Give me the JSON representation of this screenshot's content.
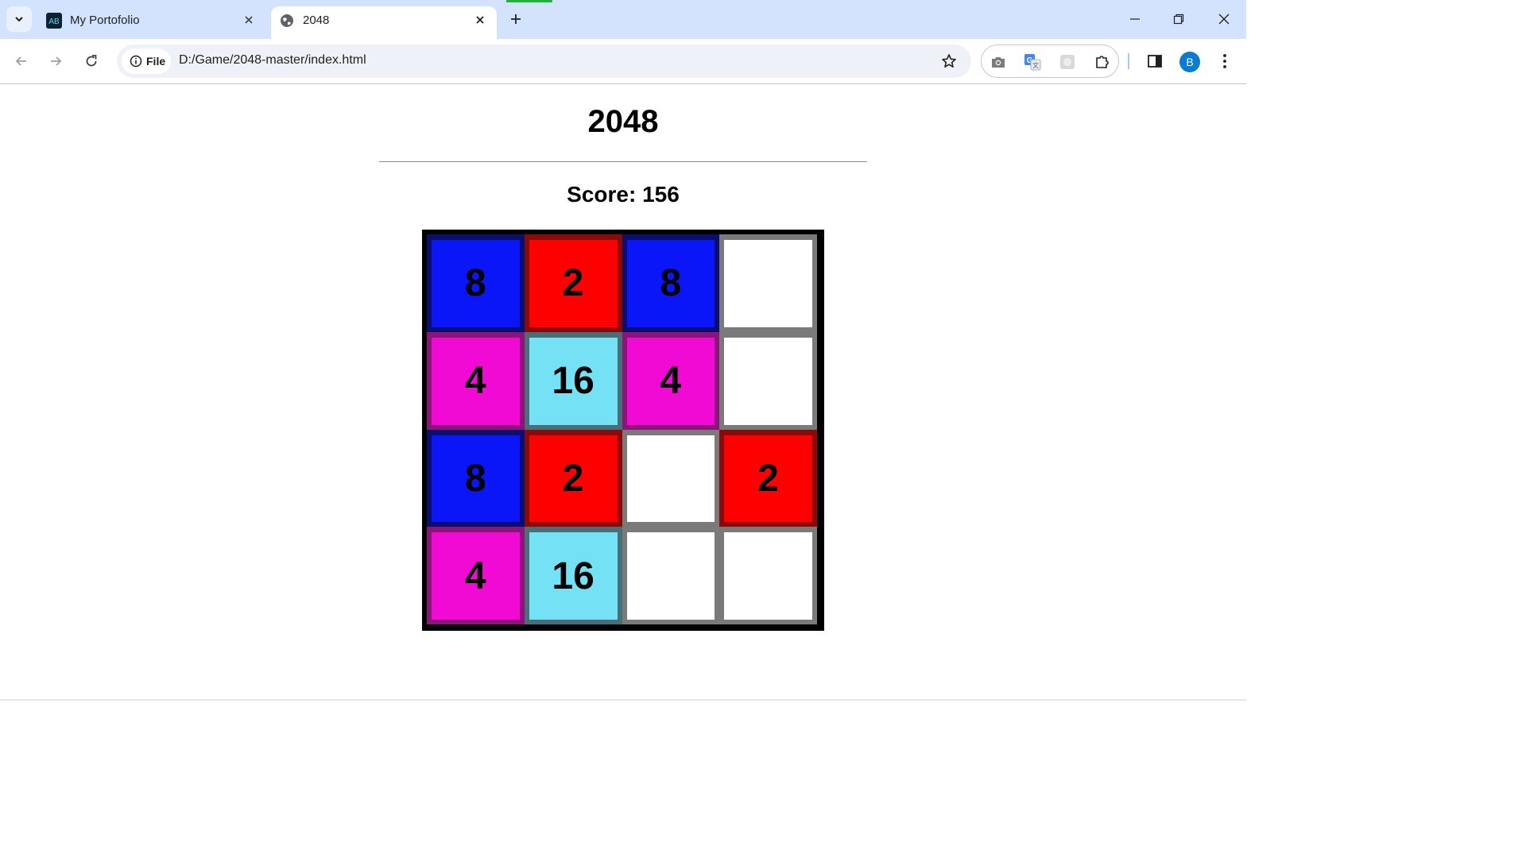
{
  "browser": {
    "tabs": [
      {
        "title": "My Portofolio",
        "icon": "portfolio-favicon",
        "active": false
      },
      {
        "title": "2048",
        "icon": "globe-icon",
        "active": true
      }
    ],
    "address": {
      "chip_label": "File",
      "url": "D:/Game/2048-master/index.html"
    },
    "profile_initial": "B",
    "colors": {
      "tabstrip": "#d3e3fd",
      "omnibox": "#eef1f8",
      "avatar": "#0b7bd1"
    }
  },
  "game": {
    "title": "2048",
    "score_label": "Score: 156",
    "board": [
      [
        "8",
        "2",
        "8",
        ""
      ],
      [
        "4",
        "16",
        "4",
        ""
      ],
      [
        "8",
        "2",
        "",
        "2"
      ],
      [
        "4",
        "16",
        "",
        ""
      ]
    ],
    "tile_colors": {
      "2": "#ff0000",
      "4": "#f00ad4",
      "8": "#0a16f7",
      "16": "#74e2f4",
      "empty": "#ffffff"
    }
  }
}
